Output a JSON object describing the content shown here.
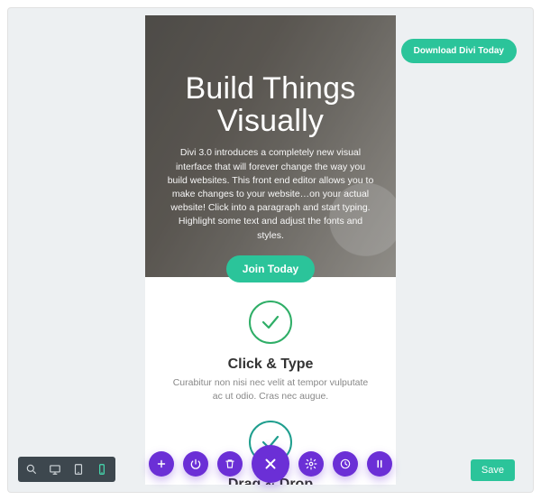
{
  "header": {
    "download_label": "Download Divi Today"
  },
  "hero": {
    "title": "Build Things Visually",
    "text": "Divi 3.0 introduces a completely new visual interface that will forever change the way you build websites. This front end editor allows you to make changes to your website…on your actual website! Click into a paragraph and start typing. Highlight some text and adjust the fonts and styles.",
    "cta_label": "Join Today"
  },
  "features": [
    {
      "title": "Click & Type",
      "text": "Curabitur non nisi nec velit at tempor vulputate ac ut odio. Cras nec augue."
    },
    {
      "title": "Drag & Drop",
      "text": ""
    }
  ],
  "footer": {
    "save_label": "Save"
  },
  "colors": {
    "accent": "#2bc49a",
    "purple": "#6b2fd6",
    "check_green": "#2fae67",
    "check_teal": "#1f9e8e"
  }
}
